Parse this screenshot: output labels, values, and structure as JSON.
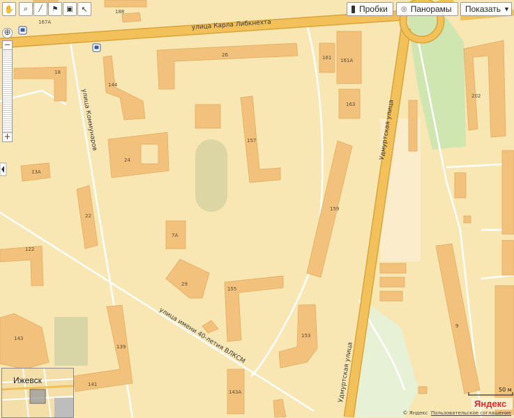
{
  "toolbar": {
    "tools": [
      {
        "name": "drag-icon",
        "glyph": "✋"
      },
      {
        "name": "zoom-area-icon",
        "glyph": "⌕"
      },
      {
        "name": "ruler-icon",
        "glyph": "📏"
      },
      {
        "name": "route-icon",
        "glyph": "⚲"
      },
      {
        "name": "layers-icon",
        "glyph": "▾"
      },
      {
        "name": "cursor-icon",
        "glyph": "↖"
      }
    ],
    "traffic_label": "Пробки",
    "panoramas_label": "Панорамы",
    "show_label": "Показать"
  },
  "streets": {
    "karla_libknekhta": "улица Карла Либкнехта",
    "kommunarov": "улица Коммунаров",
    "udmurtskaya_a": "Удмуртская улица",
    "udmurtskaya_b": "Удмуртская улица",
    "vlksm": "улица имени 40-летия ВЛКСМ"
  },
  "buildings": {
    "b188": "188",
    "b167a": "167А",
    "b26": "26",
    "b161": "161",
    "b161a": "161А",
    "b18": "18",
    "b144": "144",
    "b163": "163",
    "b202": "202",
    "b157": "157",
    "b24": "24",
    "b13a": "13А",
    "b159": "159",
    "b22": "22",
    "b7a": "7А",
    "b122": "122",
    "b29": "29",
    "b155": "155",
    "b153": "153",
    "b143": "143",
    "b139": "139",
    "b141": "141",
    "b143a": "143А",
    "b9": "9"
  },
  "minimap": {
    "city": "Ижевск"
  },
  "scale": {
    "label": "50 м"
  },
  "footer": {
    "copyright": "© Яндекс",
    "agreement": "Пользовательское соглашение",
    "logo": "Яндекс"
  },
  "colors": {
    "land": "#f8e6b3",
    "building": "#f2c27c",
    "road_major": "#f2c15a",
    "road_major_edge": "#d9a43a",
    "road_minor": "#ffffff",
    "green": "#cfe6b0",
    "stadium": "#d9d7a8"
  }
}
